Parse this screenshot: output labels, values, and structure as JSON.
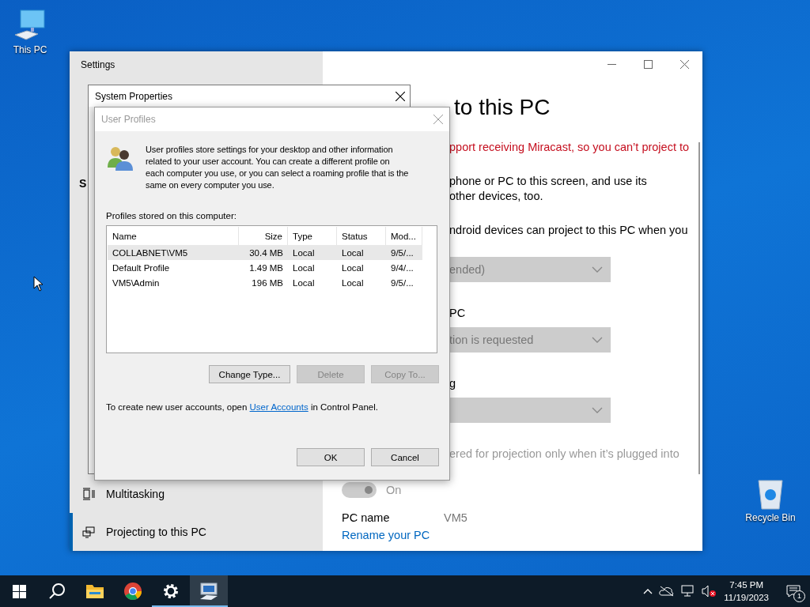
{
  "desktop_icons": [
    {
      "kind": "computer",
      "label": "This PC"
    },
    {
      "kind": "bin",
      "label": "Recycle Bin"
    }
  ],
  "settings": {
    "title": "Settings",
    "sidebar_heading": "S",
    "sidebar_items": [
      {
        "kind": "multitasking",
        "label": "Multitasking",
        "selected": false
      },
      {
        "kind": "projecting",
        "label": "Projecting to this PC",
        "selected": true
      }
    ],
    "content": [
      {
        "kind": "heading",
        "lines": [
          "to this PC"
        ]
      },
      {
        "kind": "warning",
        "lines": [
          "pport receiving Miracast, so you can’t project to"
        ]
      },
      {
        "kind": "text",
        "lines": [
          "phone or PC to this screen, and use its",
          "other devices, too."
        ]
      },
      {
        "kind": "text",
        "lines": [
          "ndroid devices can project to this PC when you"
        ]
      },
      {
        "kind": "dropdown",
        "value": "ended)",
        "disabled": true
      },
      {
        "kind": "label",
        "lines": [
          "PC"
        ]
      },
      {
        "kind": "dropdown",
        "value": "tion is requested",
        "disabled": true
      },
      {
        "kind": "label",
        "lines": [
          "g"
        ]
      },
      {
        "kind": "dropdown",
        "disabled": true
      },
      {
        "kind": "disabled_text",
        "lines": [
          "ered for projection only when it’s plugged into"
        ]
      },
      {
        "kind": "toggle",
        "on": true,
        "disabled": true,
        "label": "On"
      },
      {
        "kind": "field",
        "label": "PC name",
        "value": "VM5"
      },
      {
        "kind": "link",
        "lines": [
          "Rename your PC"
        ]
      }
    ]
  },
  "system_properties": {
    "title": "System Properties"
  },
  "user_profiles": {
    "title": "User Profiles",
    "description": [
      "User profiles store settings for your desktop and other information",
      "related to your user account. You can create a different profile on",
      "each computer you use, or you can select a roaming profile that is the",
      "same on every computer you use."
    ],
    "list_label": "Profiles stored on this computer:",
    "columns": [
      "Name",
      "Size",
      "Type",
      "Status",
      "Mod..."
    ],
    "rows": [
      {
        "cells": [
          "COLLABNET\\VM5",
          "30.4 MB",
          "Local",
          "Local",
          "9/5/..."
        ],
        "selected": true
      },
      {
        "cells": [
          "Default Profile",
          "1.49 MB",
          "Local",
          "Local",
          "9/4/..."
        ],
        "selected": false
      },
      {
        "cells": [
          "VM5\\Admin",
          "196 MB",
          "Local",
          "Local",
          "9/5/..."
        ],
        "selected": false
      }
    ],
    "buttons": [
      {
        "label": "Change Type...",
        "disabled": false
      },
      {
        "label": "Delete",
        "disabled": true
      },
      {
        "label": "Copy To...",
        "disabled": true
      }
    ],
    "footer_before": "To create new user accounts, open",
    "footer_link": "User Accounts",
    "footer_after": "in Control Panel.",
    "actions": [
      {
        "label": "OK"
      },
      {
        "label": "Cancel"
      }
    ]
  },
  "taskbar": {
    "apps": [
      {
        "kind": "start",
        "open": false,
        "active": false
      },
      {
        "kind": "search",
        "open": false,
        "active": false
      },
      {
        "kind": "folder",
        "open": false,
        "active": false
      },
      {
        "kind": "browser",
        "open": false,
        "active": false
      },
      {
        "kind": "settings",
        "open": true,
        "active": false
      },
      {
        "kind": "system",
        "open": true,
        "active": true
      }
    ],
    "time": "7:45 PM",
    "date": "11/19/2023",
    "notifications": "1"
  }
}
